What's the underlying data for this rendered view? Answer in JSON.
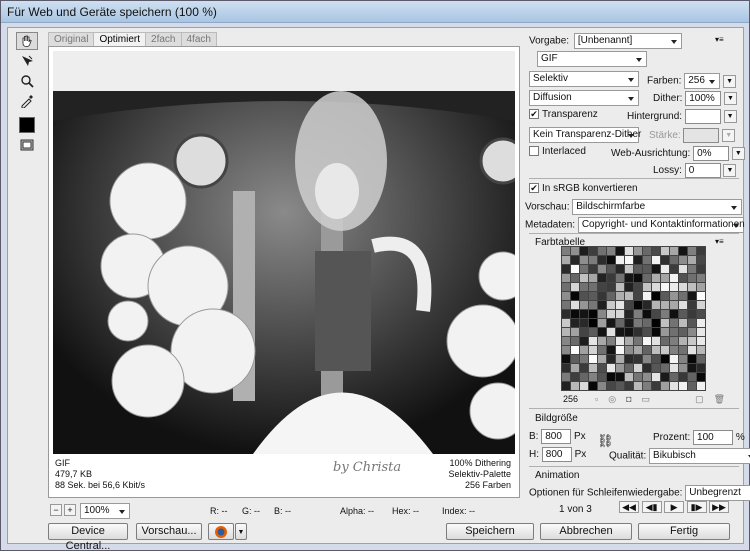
{
  "window": {
    "title": "Für Web und Geräte speichern (100 %)"
  },
  "tabs": [
    "Original",
    "Optimiert",
    "2fach",
    "4fach"
  ],
  "image_info": {
    "left": [
      "GIF",
      "479,7 KB",
      "88 Sek. bei 56,6 Kbit/s"
    ],
    "right": [
      "100% Dithering",
      "Selektiv-Palette",
      "256 Farben"
    ],
    "signature": "by Christa"
  },
  "zoom": {
    "minus": "−",
    "plus": "+",
    "value": "100%",
    "r": "R: --",
    "g": "G: --",
    "b": "B: --",
    "alpha": "Alpha: --",
    "hex": "Hex: --",
    "index": "Index: --"
  },
  "buttons": {
    "device_central": "Device Central...",
    "preview": "Vorschau...",
    "save": "Speichern",
    "cancel": "Abbrechen",
    "done": "Fertig"
  },
  "settings": {
    "preset_label": "Vorgabe:",
    "preset_value": "[Unbenannt]",
    "format": "GIF",
    "reduction": "Selektiv",
    "colors_label": "Farben:",
    "colors_value": "256",
    "dither_algo": "Diffusion",
    "dither_label": "Dither:",
    "dither_value": "100%",
    "transparency_label": "Transparenz",
    "matte_label": "Hintergrund:",
    "transp_dither": "Kein Transparenz-Dither",
    "amount_label": "Stärke:",
    "interlaced_label": "Interlaced",
    "web_snap_label": "Web-Ausrichtung:",
    "web_snap_value": "0%",
    "lossy_label": "Lossy:",
    "lossy_value": "0",
    "srgb_label": "In sRGB konvertieren",
    "preview_label": "Vorschau:",
    "preview_value": "Bildschirmfarbe",
    "metadata_label": "Metadaten:",
    "metadata_value": "Copyright- und Kontaktinformationen"
  },
  "color_table": {
    "title": "Farbtabelle",
    "count": "256"
  },
  "image_size": {
    "title": "Bildgröße",
    "w_label": "B:",
    "w_value": "800",
    "h_label": "H:",
    "h_value": "800",
    "unit": "Px",
    "percent_label": "Prozent:",
    "percent_value": "100",
    "percent_unit": "%",
    "quality_label": "Qualität:",
    "quality_value": "Bikubisch"
  },
  "animation": {
    "title": "Animation",
    "loop_label": "Optionen für Schleifenwiedergabe:",
    "loop_value": "Unbegrenzt",
    "frame": "1 von 3"
  }
}
